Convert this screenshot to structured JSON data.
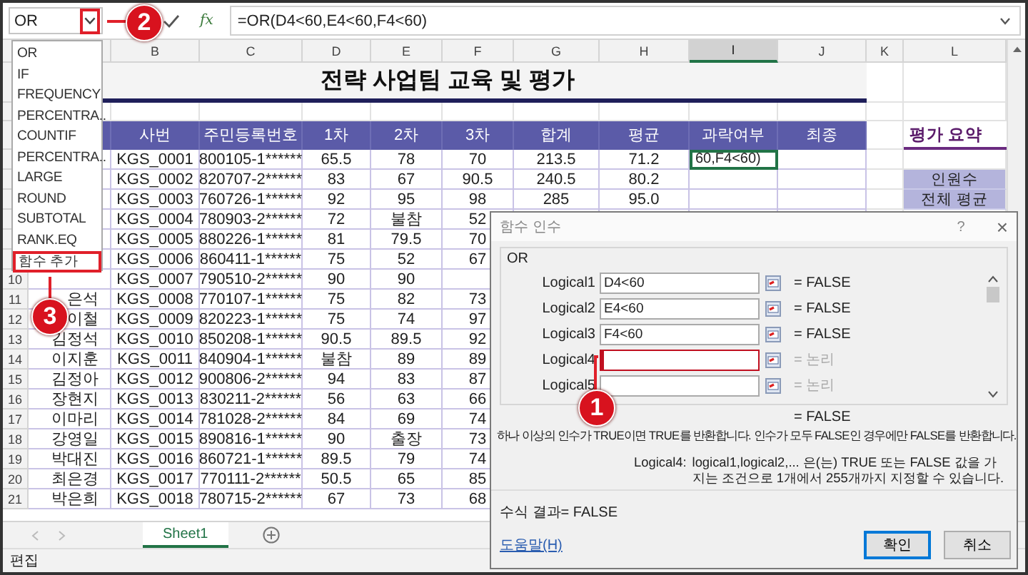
{
  "formula_bar": {
    "name_box": "OR",
    "arrow_highlighted": true,
    "insert_function": "fx",
    "formula": "=OR(D4<60,E4<60,F4<60)"
  },
  "name_dropdown": {
    "items": [
      {
        "label": "OR",
        "highlighted": false
      },
      {
        "label": "IF",
        "highlighted": false
      },
      {
        "label": "FREQUENCY",
        "highlighted": false
      },
      {
        "label": "PERCENTRA..",
        "highlighted": false
      },
      {
        "label": "COUNTIF",
        "highlighted": false
      },
      {
        "label": "PERCENTRA..",
        "highlighted": false
      },
      {
        "label": "LARGE",
        "highlighted": false
      },
      {
        "label": "ROUND",
        "highlighted": false
      },
      {
        "label": "SUBTOTAL",
        "highlighted": false
      },
      {
        "label": "RANK.EQ",
        "highlighted": false
      },
      {
        "label": "함수 추가",
        "highlighted": true
      }
    ]
  },
  "sheet": {
    "columns": [
      {
        "letter": "B",
        "selected": false
      },
      {
        "letter": "C",
        "selected": false
      },
      {
        "letter": "D",
        "selected": false
      },
      {
        "letter": "E",
        "selected": false
      },
      {
        "letter": "F",
        "selected": false
      },
      {
        "letter": "G",
        "selected": false
      },
      {
        "letter": "H",
        "selected": false
      },
      {
        "letter": "I",
        "selected": true
      },
      {
        "letter": "J",
        "selected": false
      },
      {
        "letter": "K",
        "selected": false
      },
      {
        "letter": "L",
        "selected": false
      }
    ],
    "title": "전략 사업팀 교육 및 평가",
    "headers": {
      "B": "사번",
      "C": "주민등록번호",
      "D": "1차",
      "E": "2차",
      "F": "3차",
      "G": "합계",
      "H": "평균",
      "I": "과락여부",
      "J": "최종",
      "L": "평가 요약"
    },
    "rows": [
      {
        "cells": {
          "B": "KGS_0001",
          "C": "800105-1******",
          "D": "65.5",
          "E": "78",
          "F": "70",
          "G": "213.5",
          "H": "71.2",
          "I": {
            "text": "60,F4<60)",
            "editing": true
          }
        }
      },
      {
        "cells": {
          "B": "KGS_0002",
          "C": "820707-2******",
          "D": "83",
          "E": "67",
          "F": "90.5",
          "G": "240.5",
          "H": "80.2",
          "L": "인원수"
        }
      },
      {
        "cells": {
          "B": "KGS_0003",
          "C": "760726-1******",
          "D": "92",
          "E": "95",
          "F": "98",
          "G": "285",
          "H": "95.0",
          "L": "전체 평균"
        }
      },
      {
        "cells": {
          "B": "KGS_0004",
          "C": "780903-2******",
          "D": "72",
          "E": "불참",
          "F": "52"
        }
      },
      {
        "cells": {
          "B": "KGS_0005",
          "C": "880226-1******",
          "D": "81",
          "E": "79.5",
          "F": "70"
        }
      },
      {
        "cells": {
          "B": "KGS_0006",
          "C": "860411-1******",
          "D": "75",
          "E": "52",
          "F": "67"
        }
      },
      {
        "number": "10",
        "cells": {
          "B": "KGS_0007",
          "C": "790510-2******",
          "D": "90",
          "E": "90"
        }
      },
      {
        "number": "11",
        "name": "은석",
        "cells": {
          "B": "KGS_0008",
          "C": "770107-1******",
          "D": "75",
          "E": "82",
          "F": "73"
        }
      },
      {
        "number": "12",
        "name": "이철",
        "cells": {
          "B": "KGS_0009",
          "C": "820223-1******",
          "D": "75",
          "E": "74",
          "F": "97"
        }
      },
      {
        "number": "13",
        "name": "김정석",
        "cells": {
          "B": "KGS_0010",
          "C": "850208-1******",
          "D": "90.5",
          "E": "89.5",
          "F": "92"
        }
      },
      {
        "number": "14",
        "name": "이지훈",
        "cells": {
          "B": "KGS_0011",
          "C": "840904-1******",
          "D": "불참",
          "E": "89",
          "F": "89"
        }
      },
      {
        "number": "15",
        "name": "김정아",
        "cells": {
          "B": "KGS_0012",
          "C": "900806-2******",
          "D": "94",
          "E": "83",
          "F": "87"
        }
      },
      {
        "number": "16",
        "name": "장현지",
        "cells": {
          "B": "KGS_0013",
          "C": "830211-2******",
          "D": "56",
          "E": "63",
          "F": "66"
        }
      },
      {
        "number": "17",
        "name": "이마리",
        "cells": {
          "B": "KGS_0014",
          "C": "781028-2******",
          "D": "84",
          "E": "69",
          "F": "74"
        }
      },
      {
        "number": "18",
        "name": "강영일",
        "cells": {
          "B": "KGS_0015",
          "C": "890816-1******",
          "D": "90",
          "E": "출장",
          "F": "73"
        }
      },
      {
        "number": "19",
        "name": "박대진",
        "cells": {
          "B": "KGS_0016",
          "C": "860721-1******",
          "D": "89.5",
          "E": "79",
          "F": "74"
        }
      },
      {
        "number": "20",
        "name": "최은경",
        "cells": {
          "B": "KGS_0017",
          "C": "770111-2******",
          "D": "50.5",
          "E": "65",
          "F": "85"
        }
      },
      {
        "number": "21",
        "name": "박은희",
        "cells": {
          "B": "KGS_0018",
          "C": "780715-2******",
          "D": "67",
          "E": "73",
          "F": "68"
        }
      }
    ]
  },
  "sheet_tabs": [
    {
      "label": "Sheet1",
      "selected": true
    }
  ],
  "status_bar": "편집",
  "dialog": {
    "title": "함수 인수",
    "help_glyph": "?",
    "close_glyph": "×",
    "function": "OR",
    "arguments": [
      {
        "label": "Logical1",
        "value": "D4<60",
        "result": "= FALSE",
        "muted": false,
        "focused": false
      },
      {
        "label": "Logical2",
        "value": "E4<60",
        "result": "= FALSE",
        "muted": false,
        "focused": false
      },
      {
        "label": "Logical3",
        "value": "F4<60",
        "result": "= FALSE",
        "muted": false,
        "focused": false
      },
      {
        "label": "Logical4",
        "result": "= 논리",
        "muted": true,
        "focused": true
      },
      {
        "label": "Logical5",
        "result": "= 논리",
        "muted": true,
        "focused": false
      }
    ],
    "overall_result": "= FALSE",
    "description": "하나 이상의 인수가 TRUE이면 TRUE를 반환합니다. 인수가 모두 FALSE인 경우에만 FALSE를 반환합니다.",
    "argument_name": "Logical4:",
    "argument_help": "logical1,logical2,... 은(는) TRUE 또는 FALSE 값을 가지는 조건으로 1개에서 255개까지 지정할 수 있습니다.",
    "formula_result": "수식 결과=  FALSE",
    "help_link": "도움말(H)",
    "buttons": [
      {
        "label": "확인",
        "default": true
      },
      {
        "label": "취소",
        "default": false
      }
    ]
  },
  "callouts": [
    {
      "number": "2",
      "kind": "formula-bar"
    },
    {
      "number": "3",
      "kind": "menu"
    },
    {
      "number": "1",
      "kind": "dialog"
    }
  ]
}
